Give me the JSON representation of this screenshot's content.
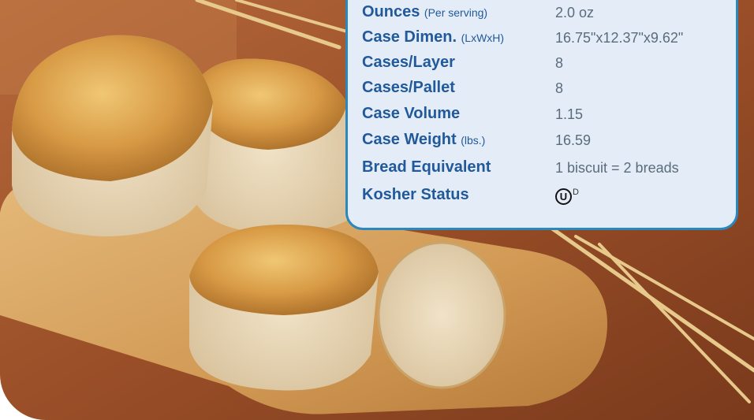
{
  "spec_table": {
    "rows": [
      {
        "label": "Ounces",
        "note": "(Per serving)",
        "value": "2.0 oz"
      },
      {
        "label": "Case Dimen.",
        "note": "(LxWxH)",
        "value": "16.75\"x12.37\"x9.62\""
      },
      {
        "label": "Cases/Layer",
        "note": "",
        "value": "8"
      },
      {
        "label": "Cases/Pallet",
        "note": "",
        "value": "8"
      },
      {
        "label": "Case Volume",
        "note": "",
        "value": "1.15"
      },
      {
        "label": "Case Weight",
        "note": "(lbs.)",
        "value": "16.59"
      },
      {
        "label": "Bread Equivalent",
        "note": "",
        "value": "1 biscuit = 2 breads"
      },
      {
        "label": "Kosher Status",
        "note": "",
        "value": ""
      }
    ],
    "kosher_symbol": "U",
    "kosher_suffix": "D"
  },
  "colors": {
    "panel_border": "#2b88bd",
    "panel_background": "#e4edf7",
    "label_text": "#21599a",
    "value_text": "#5a6c7c"
  }
}
